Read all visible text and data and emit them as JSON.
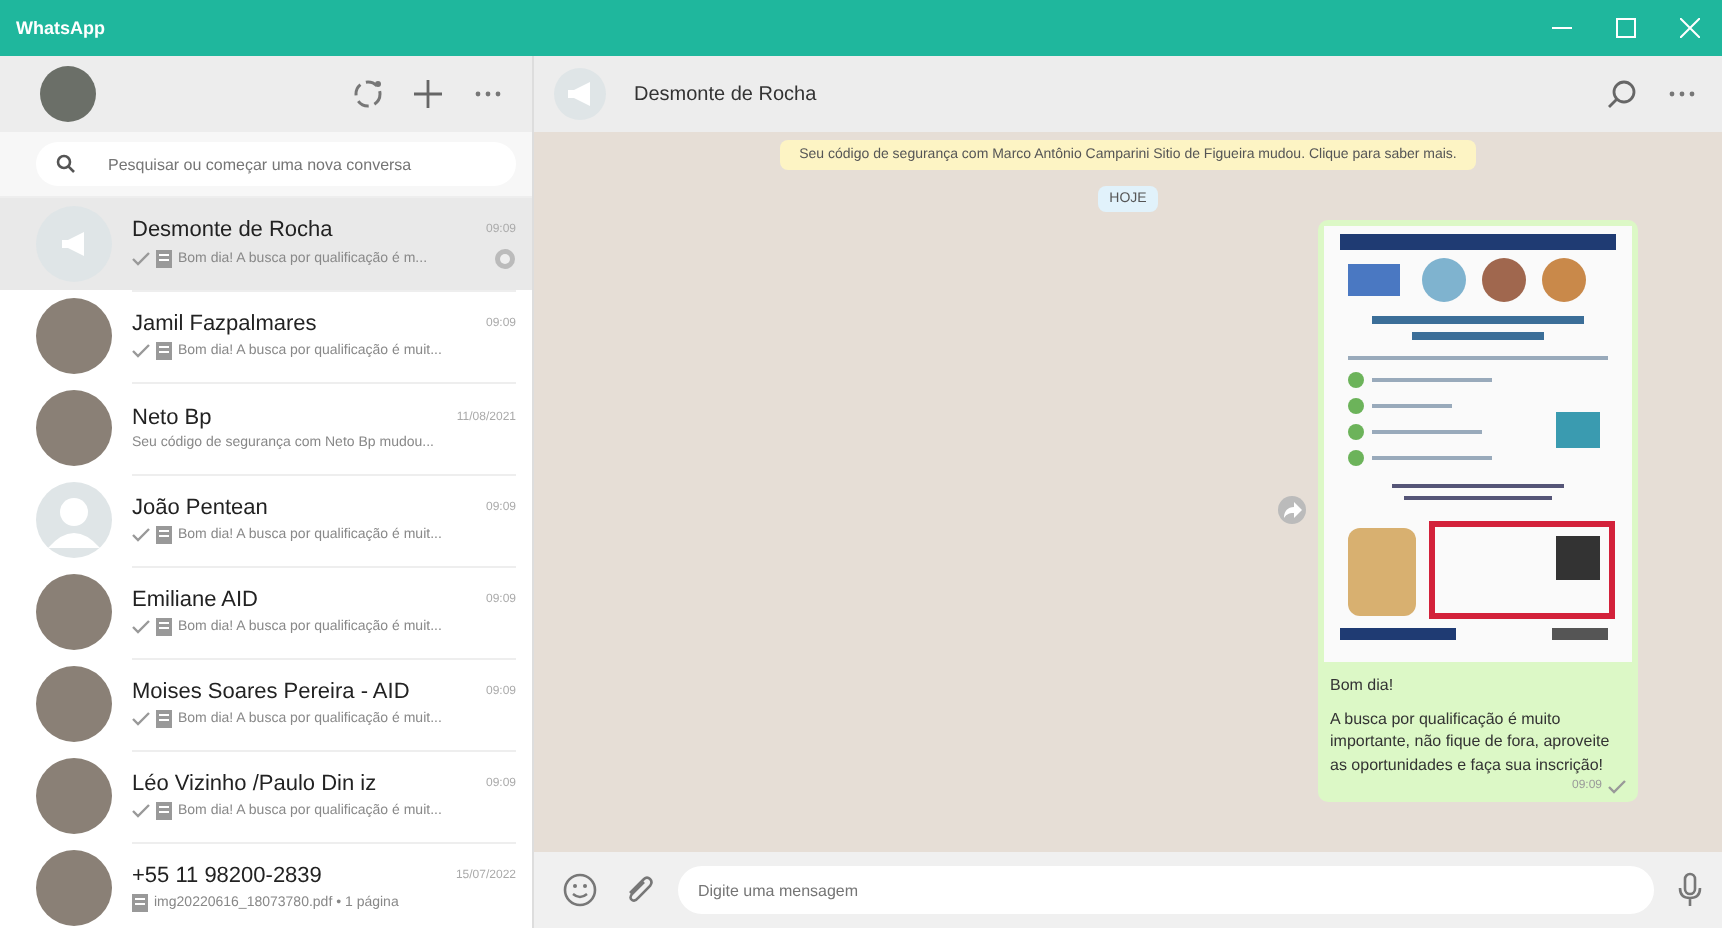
{
  "window": {
    "title": "WhatsApp"
  },
  "sidebar": {
    "search": {
      "placeholder": "Pesquisar ou começar uma nova conversa"
    },
    "chats": [
      {
        "name": "Desmonte de Rocha",
        "time": "09:09",
        "preview": "Bom dia! A busca por qualificação é m...",
        "sent": true,
        "attachment": true,
        "pinned": true,
        "selected": true,
        "kind": "group"
      },
      {
        "name": "Jamil Fazpalmares",
        "time": "09:09",
        "preview": "Bom dia! A busca por qualificação é muit...",
        "sent": true,
        "attachment": true,
        "pinned": false,
        "selected": false,
        "kind": "photo"
      },
      {
        "name": "Neto Bp",
        "time": "11/08/2021",
        "preview": "Seu código de segurança com Neto Bp mudou...",
        "sent": false,
        "attachment": false,
        "pinned": false,
        "selected": false,
        "kind": "photo"
      },
      {
        "name": "João Pentean",
        "time": "09:09",
        "preview": "Bom dia! A busca por qualificação é muit...",
        "sent": true,
        "attachment": true,
        "pinned": false,
        "selected": false,
        "kind": "default"
      },
      {
        "name": "Emiliane AID",
        "time": "09:09",
        "preview": "Bom dia! A busca por qualificação é muit...",
        "sent": true,
        "attachment": true,
        "pinned": false,
        "selected": false,
        "kind": "photo"
      },
      {
        "name": "Moises Soares Pereira - AID",
        "time": "09:09",
        "preview": "Bom dia! A busca por qualificação é muit...",
        "sent": true,
        "attachment": true,
        "pinned": false,
        "selected": false,
        "kind": "photo"
      },
      {
        "name": "Léo Vizinho /Paulo Din iz",
        "time": "09:09",
        "preview": "Bom dia! A busca por qualificação é muit...",
        "sent": true,
        "attachment": true,
        "pinned": false,
        "selected": false,
        "kind": "photo"
      },
      {
        "name": "+55 11 98200-2839",
        "time": "15/07/2022",
        "preview": "img20220616_18073780.pdf • 1 página",
        "sent": false,
        "attachment": true,
        "pinned": false,
        "selected": false,
        "kind": "photo"
      }
    ]
  },
  "chat": {
    "title": "Desmonte de Rocha",
    "notice": "Seu código de segurança com Marco Antônio Camparini Sitio de Figueira mudou. Clique para saber mais.",
    "date": "HOJE",
    "message": {
      "greeting": "Bom dia!",
      "body": "A busca por qualificação é muito importante, não fique de fora, aproveite as oportunidades e faça sua inscrição!",
      "time": "09:09",
      "sent": true
    },
    "composer": {
      "placeholder": "Digite uma mensagem"
    }
  }
}
